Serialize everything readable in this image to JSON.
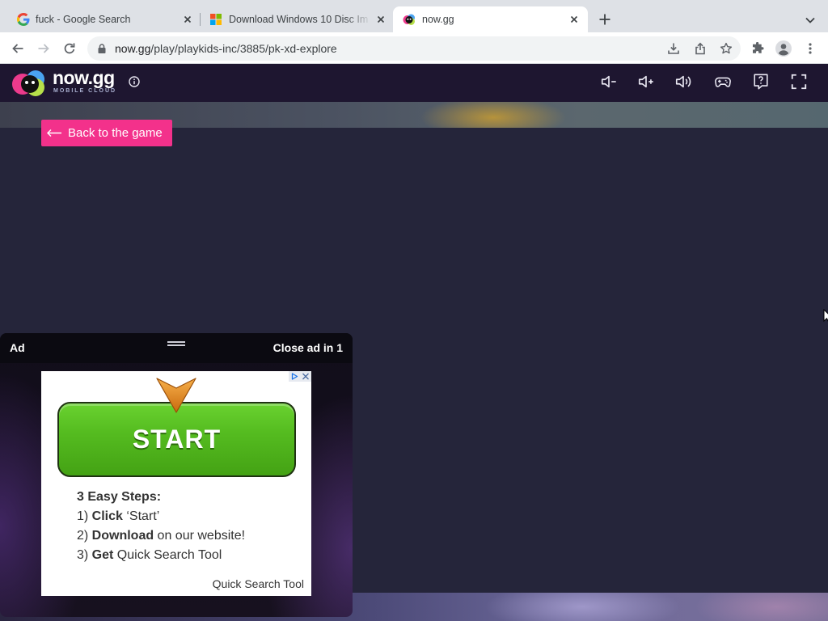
{
  "colors": {
    "accent": "#f3318b",
    "header_bg": "#1e1630",
    "game_bg": "#25253a",
    "cta_green": "#4caf1e",
    "arrow_orange": "#f0952a"
  },
  "browser": {
    "tabs": [
      {
        "title": "fuck - Google Search",
        "icon": "google-icon",
        "active": false
      },
      {
        "title": "Download Windows 10 Disc Im",
        "icon": "windows-icon",
        "active": false
      },
      {
        "title": "now.gg",
        "icon": "nowgg-icon",
        "active": true
      }
    ],
    "address_bar": {
      "host": "now.gg",
      "path": "/play/playkids-inc/3885/pk-xd-explore"
    },
    "toolbar_icons": [
      "back-icon",
      "forward-icon",
      "reload-icon",
      "lock-icon",
      "download-icon",
      "share-icon",
      "star-icon",
      "extensions-icon",
      "profile-icon",
      "menu-icon"
    ]
  },
  "app_header": {
    "logo_text": "now.gg",
    "logo_subtitle": "MOBILE CLOUD",
    "controls": [
      "info-icon",
      "volume-down-icon",
      "volume-up-icon",
      "volume-icon",
      "gamepad-icon",
      "help-icon",
      "fullscreen-icon"
    ]
  },
  "game": {
    "back_button_label": "Back to the game"
  },
  "ad": {
    "label": "Ad",
    "close_text": "Close ad in 1",
    "cta_label": "START",
    "steps_title": "3 Easy Steps:",
    "steps": [
      {
        "number": "1) ",
        "action": "Click",
        "detail": " ‘Start’"
      },
      {
        "number": "2) ",
        "action": "Download",
        "detail": " on our website!"
      },
      {
        "number": "3) ",
        "action": "Get",
        "detail": " Quick Search Tool"
      }
    ],
    "brand": "Quick Search Tool"
  }
}
